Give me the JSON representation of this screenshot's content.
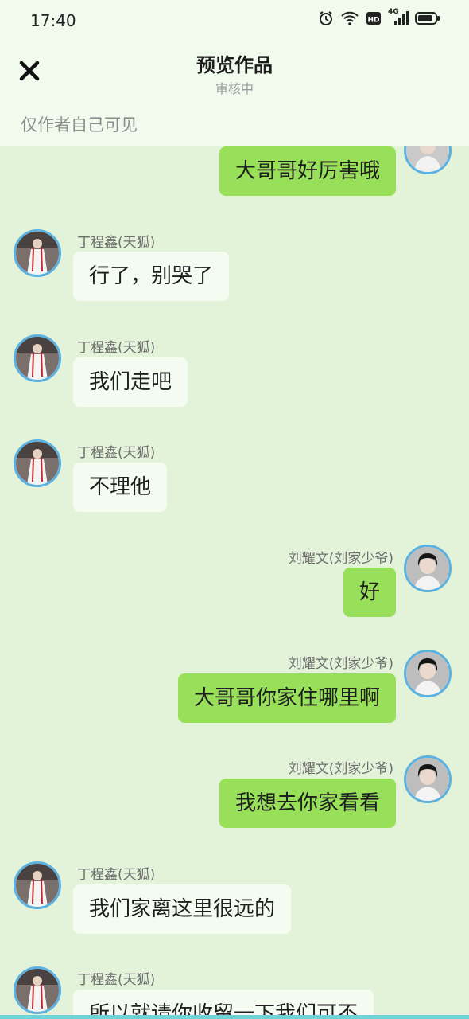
{
  "status_bar": {
    "time": "17:40",
    "network": "4G"
  },
  "header": {
    "title": "预览作品",
    "subtitle": "审核中",
    "visibility_note": "仅作者自己可见"
  },
  "messages": [
    {
      "side": "right",
      "sender": "",
      "text": "大哥哥好厉害哦"
    },
    {
      "side": "left",
      "sender": "丁程鑫(天狐)",
      "text": "行了，别哭了"
    },
    {
      "side": "left",
      "sender": "丁程鑫(天狐)",
      "text": "我们走吧"
    },
    {
      "side": "left",
      "sender": "丁程鑫(天狐)",
      "text": "不理他"
    },
    {
      "side": "right",
      "sender": "刘耀文(刘家少爷)",
      "text": "好"
    },
    {
      "side": "right",
      "sender": "刘耀文(刘家少爷)",
      "text": "大哥哥你家住哪里啊"
    },
    {
      "side": "right",
      "sender": "刘耀文(刘家少爷)",
      "text": "我想去你家看看"
    },
    {
      "side": "left",
      "sender": "丁程鑫(天狐)",
      "text": "我们家离这里很远的"
    },
    {
      "side": "left",
      "sender": "丁程鑫(天狐)",
      "text": "所以就请你收留一下我们可不"
    }
  ],
  "colors": {
    "page_bg": "#e3f3da",
    "header_bg": "#f1fbed",
    "own_bubble": "#99e05a",
    "other_bubble": "#f4fbf0",
    "avatar_ring": "#5bb1e0"
  }
}
